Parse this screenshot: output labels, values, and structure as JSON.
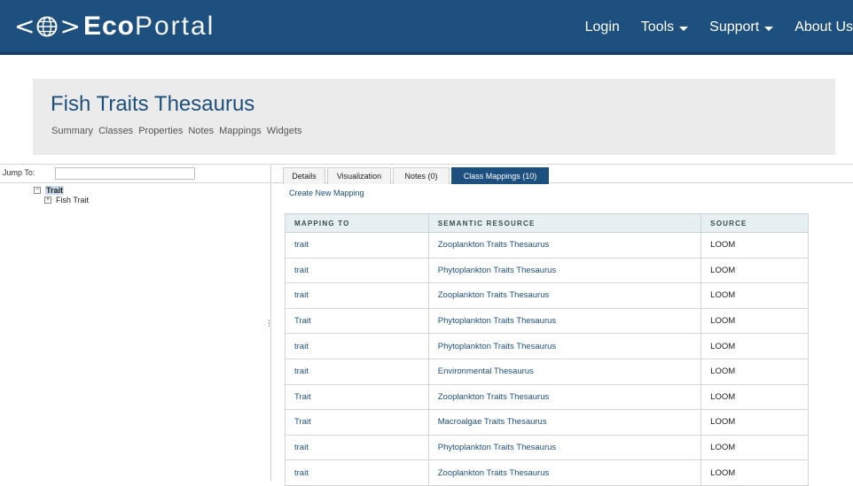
{
  "brand": {
    "left_bracket": "<",
    "right_bracket": ">",
    "name_bold": "Eco",
    "name_light": "Portal"
  },
  "nav": {
    "login": "Login",
    "tools": "Tools",
    "support": "Support",
    "about": "About Us"
  },
  "ontology": {
    "title": "Fish Traits Thesaurus",
    "tabs": [
      "Summary",
      "Classes",
      "Properties",
      "Notes",
      "Mappings",
      "Widgets"
    ]
  },
  "tree": {
    "jump_label": "Jump To:",
    "jump_value": "",
    "root_toggle": "−",
    "root_label": "Trait",
    "child_toggle": "+",
    "child_label": "Fish Trait"
  },
  "class_tabs": {
    "details": "Details",
    "visualization": "Visualization",
    "notes": "Notes (0)",
    "class_mappings": "Class Mappings (10)"
  },
  "create_mapping": "Create New Mapping",
  "mapping_table": {
    "headers": [
      "MAPPING TO",
      "SEMANTIC RESOURCE",
      "SOURCE"
    ],
    "rows": [
      [
        "trait",
        "Zooplankton Traits Thesaurus",
        "LOOM"
      ],
      [
        "trait",
        "Phytoplankton Traits Thesaurus",
        "LOOM"
      ],
      [
        "trait",
        "Zooplankton Traits Thesaurus",
        "LOOM"
      ],
      [
        "Trait",
        "Phytoplankton Traits Thesaurus",
        "LOOM"
      ],
      [
        "trait",
        "Phytoplankton Traits Thesaurus",
        "LOOM"
      ],
      [
        "trait",
        "Environmental Thesaurus",
        "LOOM"
      ],
      [
        "Trait",
        "Zooplankton Traits Thesaurus",
        "LOOM"
      ],
      [
        "Trait",
        "Macroalgae Traits Thesaurus",
        "LOOM"
      ],
      [
        "trait",
        "Phytoplankton Traits Thesaurus",
        "LOOM"
      ],
      [
        "trait",
        "Zooplankton Traits Thesaurus",
        "LOOM"
      ]
    ]
  },
  "colors": {
    "brand_blue": "#1d4f7f",
    "header_gray": "#ebebeb",
    "table_header_bg": "#e6eff1",
    "tree_highlight": "#c7d9ea"
  },
  "icons": {
    "logo": "globe-icon",
    "dropdown": "caret-down-icon",
    "tree_expand": "plus-box-icon",
    "tree_collapse": "minus-box-icon",
    "splitter": "grip-icon"
  }
}
